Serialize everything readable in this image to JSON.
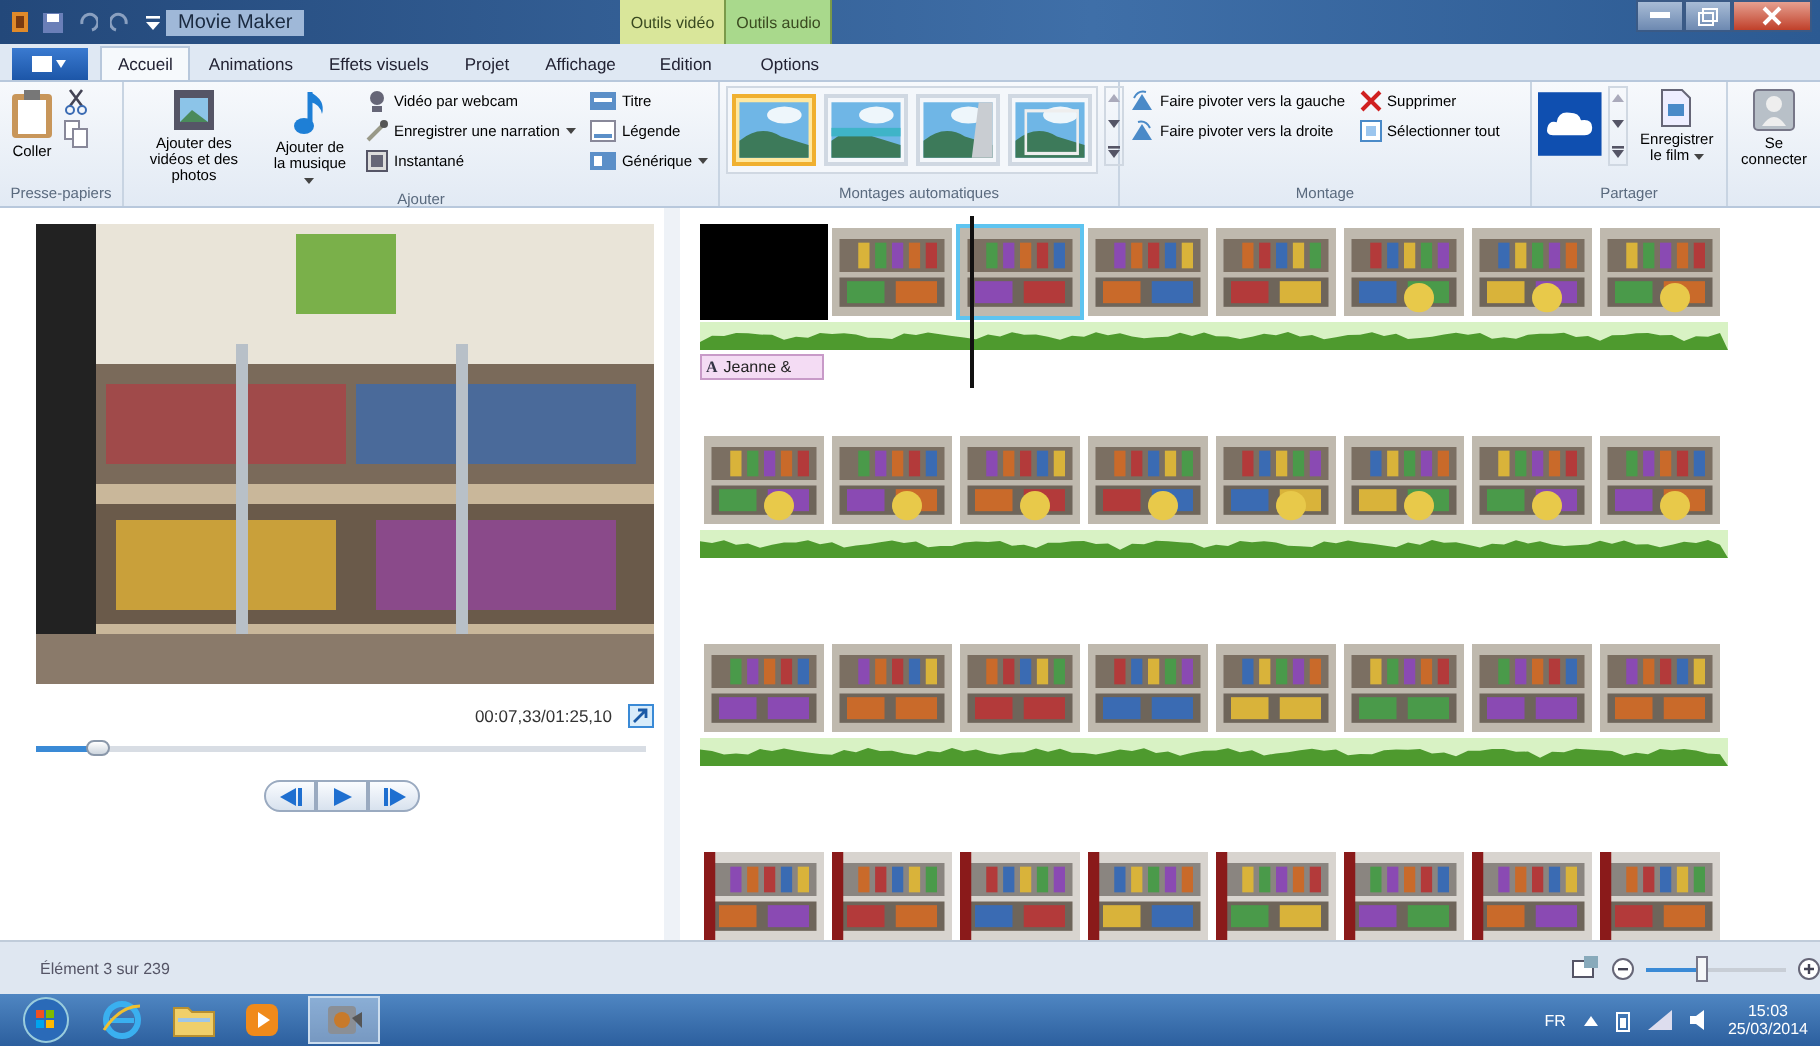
{
  "window": {
    "title": "Movie Maker"
  },
  "contextual_tabs": [
    {
      "label": "Outils vidéo",
      "color": "#d9e69a"
    },
    {
      "label": "Outils audio",
      "color": "#a9d98c"
    }
  ],
  "tabs": [
    {
      "label": "Accueil",
      "selected": true
    },
    {
      "label": "Animations",
      "selected": false
    },
    {
      "label": "Effets visuels",
      "selected": false
    },
    {
      "label": "Projet",
      "selected": false
    },
    {
      "label": "Affichage",
      "selected": false
    },
    {
      "label": "Edition",
      "selected": false
    },
    {
      "label": "Options",
      "selected": false
    }
  ],
  "ribbon": {
    "clipboard": {
      "label": "Presse-papiers",
      "paste": "Coller"
    },
    "add": {
      "label": "Ajouter",
      "videos": "Ajouter des vidéos et des photos",
      "music": "Ajouter de la musique",
      "webcam": "Vidéo par webcam",
      "narration": "Enregistrer une narration",
      "snapshot": "Instantané",
      "title": "Titre",
      "caption": "Légende",
      "credits": "Générique"
    },
    "themes": {
      "label": "Montages automatiques",
      "items": [
        {
          "selected": true
        },
        {
          "selected": false
        },
        {
          "selected": false
        },
        {
          "selected": false
        }
      ]
    },
    "editing": {
      "label": "Montage",
      "rotate_left": "Faire pivoter vers la gauche",
      "rotate_right": "Faire pivoter vers la droite",
      "remove": "Supprimer",
      "select_all": "Sélectionner tout"
    },
    "share": {
      "label": "Partager",
      "save": "Enregistrer le film"
    },
    "sign_in": "Se connecter"
  },
  "preview": {
    "time": "00:07,33/01:25,10",
    "position": {
      "level": 0.1
    }
  },
  "strips": [
    {
      "audio": true,
      "caption": {
        "icon": "A",
        "text": "Jeanne &"
      },
      "frames": [
        {
          "kind": "black",
          "selected": false
        },
        {
          "kind": "picture",
          "selected": false
        },
        {
          "kind": "picture",
          "selected": true
        },
        {
          "kind": "picture",
          "selected": false
        },
        {
          "kind": "picture",
          "selected": false
        },
        {
          "kind": "picture",
          "selected": false
        },
        {
          "kind": "picture",
          "selected": false
        },
        {
          "kind": "picture",
          "selected": false
        }
      ]
    },
    {
      "audio": true,
      "frames": [
        {
          "kind": "picture",
          "selected": false
        },
        {
          "kind": "picture",
          "selected": false
        },
        {
          "kind": "picture",
          "selected": false
        },
        {
          "kind": "picture",
          "selected": false
        },
        {
          "kind": "picture",
          "selected": false
        },
        {
          "kind": "picture",
          "selected": false
        },
        {
          "kind": "picture",
          "selected": false
        },
        {
          "kind": "picture",
          "selected": false
        }
      ]
    },
    {
      "audio": true,
      "frames": [
        {
          "kind": "picture",
          "selected": false
        },
        {
          "kind": "picture",
          "selected": false
        },
        {
          "kind": "picture",
          "selected": false
        },
        {
          "kind": "picture",
          "selected": false
        },
        {
          "kind": "picture",
          "selected": false
        },
        {
          "kind": "picture",
          "selected": false
        },
        {
          "kind": "picture",
          "selected": false
        },
        {
          "kind": "picture",
          "selected": false
        }
      ]
    },
    {
      "frames": [
        {
          "kind": "picture",
          "selected": false
        },
        {
          "kind": "picture",
          "selected": false
        },
        {
          "kind": "picture",
          "selected": false
        },
        {
          "kind": "picture",
          "selected": false
        },
        {
          "kind": "picture",
          "selected": false
        },
        {
          "kind": "picture",
          "selected": false
        },
        {
          "kind": "picture",
          "selected": false
        },
        {
          "kind": "picture",
          "selected": false
        }
      ]
    }
  ],
  "status_bar": {
    "text": "Élément 3 sur 239",
    "zoom": {
      "level": 0.4
    }
  },
  "taskbar": {
    "language": "FR",
    "time": "15:03",
    "date": "25/03/2014"
  }
}
